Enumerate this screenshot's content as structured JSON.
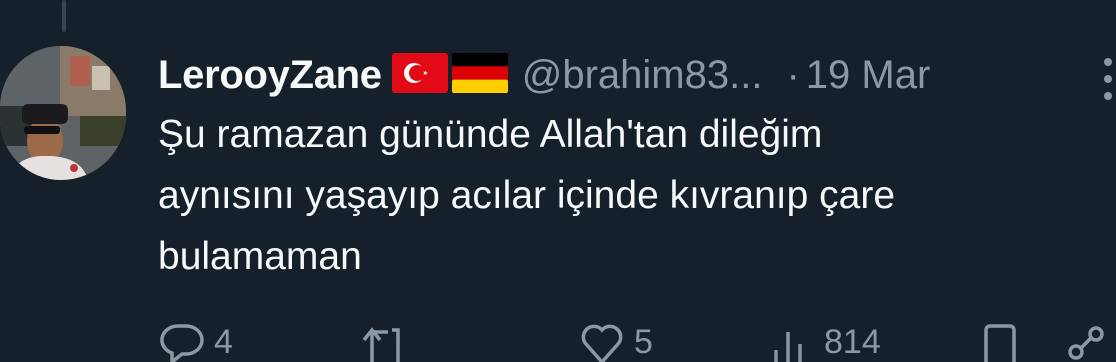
{
  "tweet": {
    "display_name": "LerooyZane",
    "flags": [
      "turkey-flag-icon",
      "germany-flag-icon"
    ],
    "handle": "@brahim83...",
    "separator": "·",
    "timestamp": "19 Mar",
    "text_lines": [
      "Şu ramazan gününde Allah'tan dileğim",
      "aynısını yaşayıp acılar içinde kıvranıp çare",
      "bulamaman"
    ]
  },
  "actions": {
    "reply": {
      "icon": "reply-icon",
      "count": "4"
    },
    "retweet": {
      "icon": "retweet-icon",
      "count": ""
    },
    "like": {
      "icon": "heart-icon",
      "count": "5"
    },
    "views": {
      "icon": "views-icon",
      "count": "814"
    },
    "bookmark": {
      "icon": "bookmark-icon"
    },
    "share": {
      "icon": "share-icon"
    }
  },
  "colors": {
    "background": "#15202b",
    "primary_text": "#f7f9f9",
    "secondary_text": "#8b98a5",
    "thread_line": "#38444d"
  }
}
